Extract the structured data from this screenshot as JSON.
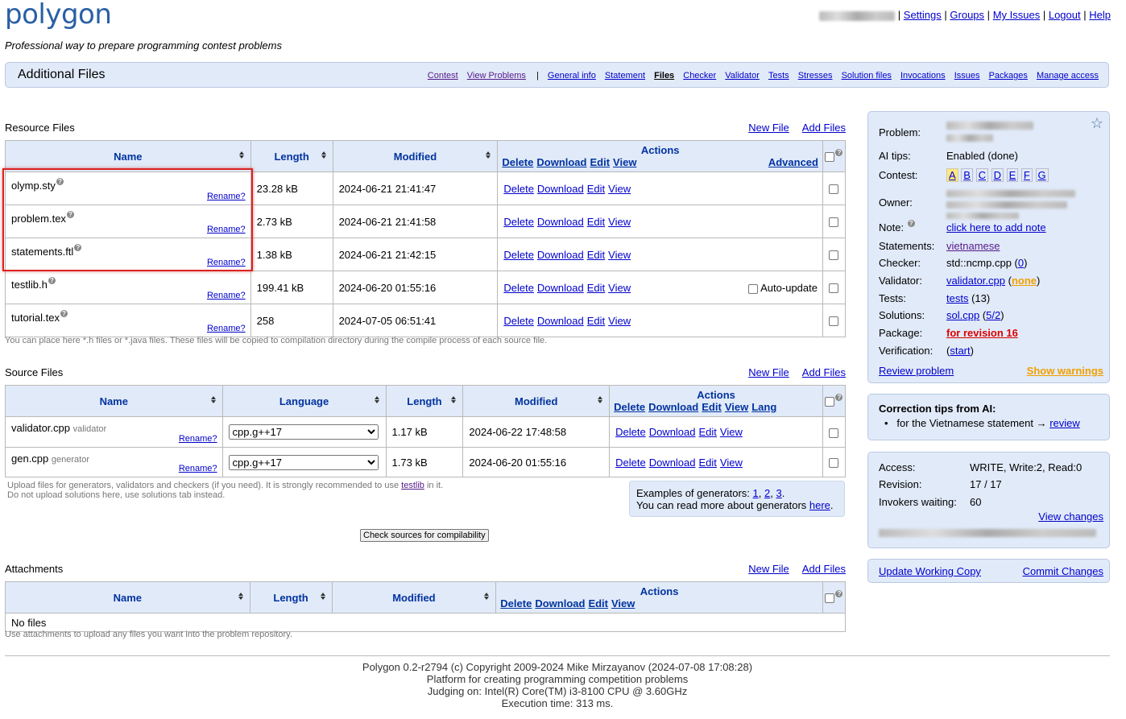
{
  "brand": {
    "logo": "polygon",
    "tagline": "Professional way to prepare programming contest problems"
  },
  "topnav": {
    "sep": "|",
    "items": [
      "Settings",
      "Groups",
      "My Issues",
      "Logout",
      "Help"
    ]
  },
  "header": {
    "title": "Additional Files",
    "menu_left": [
      "Contest",
      "View Problems"
    ],
    "menu_sep": "|",
    "menu": [
      "General info",
      "Statement",
      "Files",
      "Checker",
      "Validator",
      "Tests",
      "Stresses",
      "Solution files",
      "Invocations",
      "Issues",
      "Packages",
      "Manage access"
    ],
    "current": "Files"
  },
  "resource": {
    "title": "Resource Files",
    "new_file": "New File",
    "add_files": "Add Files",
    "cols": {
      "name": "Name",
      "length": "Length",
      "modified": "Modified",
      "actions": "Actions",
      "advanced": "Advanced"
    },
    "actions": [
      "Delete",
      "Download",
      "Edit",
      "View"
    ],
    "rename": "Rename?",
    "rows": [
      {
        "name": "olymp.sty",
        "length": "23.28 kB",
        "modified": "2024-06-21 21:41:47"
      },
      {
        "name": "problem.tex",
        "length": "2.73 kB",
        "modified": "2024-06-21 21:41:58"
      },
      {
        "name": "statements.ftl",
        "length": "1.38 kB",
        "modified": "2024-06-21 21:42:15"
      },
      {
        "name": "testlib.h",
        "length": "199.41 kB",
        "modified": "2024-06-20 01:55:16",
        "extra": "Auto-update"
      },
      {
        "name": "tutorial.tex",
        "length": "258",
        "modified": "2024-07-05 06:51:41"
      }
    ],
    "note": "You can place here *.h files or *.java files. These files will be copied to compilation directory during the compile process of each source file."
  },
  "source": {
    "title": "Source Files",
    "new_file": "New File",
    "add_files": "Add Files",
    "cols": {
      "name": "Name",
      "language": "Language",
      "length": "Length",
      "modified": "Modified",
      "actions": "Actions"
    },
    "actions": [
      "Delete",
      "Download",
      "Edit",
      "View",
      "Lang"
    ],
    "rows": [
      {
        "name": "validator.cpp",
        "tag": "validator",
        "language": "cpp.g++17",
        "length": "1.17 kB",
        "modified": "2024-06-22 17:48:58"
      },
      {
        "name": "gen.cpp",
        "tag": "generator",
        "language": "cpp.g++17",
        "length": "1.73 kB",
        "modified": "2024-06-20 01:55:16"
      }
    ],
    "note1_a": "Upload files for generators, validators and checkers (if you need). It is strongly recommended to use ",
    "note1_link": "testlib",
    "note1_b": " in it.",
    "note2": "Do not upload solutions here, use solutions tab instead.",
    "examples_label": "Examples of generators:",
    "examples": [
      "1",
      "2",
      "3"
    ],
    "readmore_a": "You can read more about generators ",
    "readmore_link": "here",
    "check_button": "Check sources for compilability"
  },
  "attachments": {
    "title": "Attachments",
    "new_file": "New File",
    "add_files": "Add Files",
    "cols": {
      "name": "Name",
      "length": "Length",
      "modified": "Modified",
      "actions": "Actions"
    },
    "actions": [
      "Delete",
      "Download",
      "Edit",
      "View"
    ],
    "empty": "No files",
    "note": "Use attachments to upload any files you want into the problem repository."
  },
  "info": {
    "problem_label": "Problem:",
    "ai_label": "AI tips:",
    "ai_value": "Enabled (done)",
    "contest_label": "Contest:",
    "contest_letters": [
      "A",
      "B",
      "C",
      "D",
      "E",
      "F",
      "G"
    ],
    "owner_label": "Owner:",
    "note_label": "Note:",
    "note_link": "click here to add note",
    "statements_label": "Statements:",
    "statements_value": "vietnamese",
    "checker_label": "Checker:",
    "checker_value": "std::ncmp.cpp",
    "checker_count": "0",
    "validator_label": "Validator:",
    "validator_value": "validator.cpp",
    "validator_extra": "none",
    "tests_label": "Tests:",
    "tests_link": "tests",
    "tests_count": "(13)",
    "solutions_label": "Solutions:",
    "solutions_link": "sol.cpp",
    "solutions_count": "5/2",
    "package_label": "Package:",
    "package_value": "for revision 16",
    "verification_label": "Verification:",
    "verification_link": "start",
    "review": "Review problem",
    "warnings": "Show warnings"
  },
  "correction": {
    "title": "Correction tips from AI:",
    "item": "for the Vietnamese statement → ",
    "link": "review"
  },
  "access": {
    "access_label": "Access:",
    "access_value": "WRITE, Write:2, Read:0",
    "revision_label": "Revision:",
    "revision_value": "17 / 17",
    "invokers_label": "Invokers waiting:",
    "invokers_value": "60",
    "view_changes": "View changes"
  },
  "working": {
    "update": "Update Working Copy",
    "commit": "Commit Changes"
  },
  "footer": {
    "line1": "Polygon 0.2-r2794 (c) Copyright 2009-2024 Mike Mirzayanov (2024-07-08 17:08:28)",
    "line2": "Platform for creating programming competition problems",
    "line3": "Judging on: Intel(R) Core(TM) i3-8100 CPU @ 3.60GHz",
    "line4": "Execution time: 313 ms."
  },
  "colors": {
    "link": "#0000cc",
    "header_bg": "#e1eaf8",
    "header_text": "#0033a0",
    "red": "#dd0000",
    "orange": "#f0a000",
    "highlight": "#dd2222"
  }
}
